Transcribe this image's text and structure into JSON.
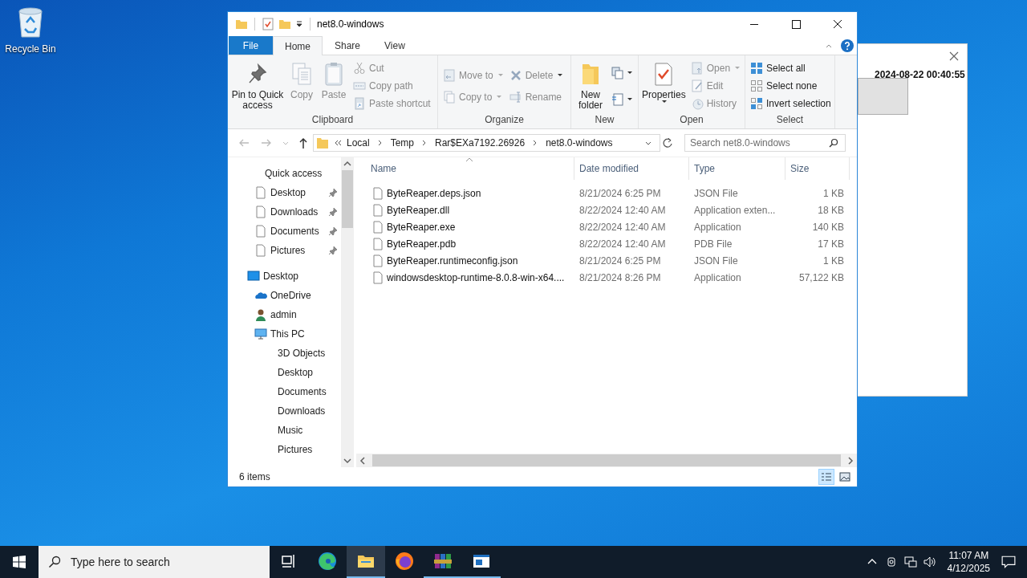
{
  "desktop_icons": [
    {
      "label": "Recycle Bin"
    }
  ],
  "background_window": {
    "timestamp": "2024-08-22 00:40:55"
  },
  "explorer": {
    "title": "net8.0-windows",
    "ribbon_tabs": [
      {
        "label": "File",
        "kind": "file",
        "selected": false
      },
      {
        "label": "Home",
        "kind": "tab",
        "selected": true
      },
      {
        "label": "Share",
        "kind": "tab",
        "selected": false
      },
      {
        "label": "View",
        "kind": "tab",
        "selected": false
      }
    ],
    "ribbon": {
      "clipboard": {
        "label": "Clipboard",
        "pin": {
          "label": "Pin to Quick access",
          "disabled": false
        },
        "copy": {
          "label": "Copy",
          "disabled": true
        },
        "paste": {
          "label": "Paste",
          "disabled": true
        },
        "cut": {
          "label": "Cut",
          "disabled": true
        },
        "copy_path": {
          "label": "Copy path",
          "disabled": true
        },
        "paste_shortcut": {
          "label": "Paste shortcut",
          "disabled": true
        }
      },
      "organize": {
        "label": "Organize",
        "move_to": {
          "label": "Move to",
          "disabled": true
        },
        "copy_to": {
          "label": "Copy to",
          "disabled": true
        },
        "delete": {
          "label": "Delete",
          "disabled": true
        },
        "rename": {
          "label": "Rename",
          "disabled": true
        }
      },
      "new": {
        "label": "New",
        "new_folder": {
          "label": "New folder",
          "disabled": false
        }
      },
      "open": {
        "label": "Open",
        "properties": {
          "label": "Properties",
          "disabled": false
        },
        "open": {
          "label": "Open",
          "disabled": true
        },
        "edit": {
          "label": "Edit",
          "disabled": true
        },
        "history": {
          "label": "History",
          "disabled": true
        }
      },
      "select": {
        "label": "Select",
        "select_all": {
          "label": "Select all",
          "disabled": false
        },
        "select_none": {
          "label": "Select none",
          "disabled": false
        },
        "invert_selection": {
          "label": "Invert selection",
          "disabled": false
        }
      }
    },
    "address": {
      "crumbs": [
        "Local",
        "Temp",
        "Rar$EXa7192.26926",
        "net8.0-windows"
      ]
    },
    "search": {
      "placeholder": "Search net8.0-windows"
    },
    "nav": {
      "quick_access": {
        "label": "Quick access",
        "items": [
          {
            "label": "Desktop",
            "pinned": true
          },
          {
            "label": "Downloads",
            "pinned": true
          },
          {
            "label": "Documents",
            "pinned": true
          },
          {
            "label": "Pictures",
            "pinned": true
          }
        ]
      },
      "tree": [
        {
          "label": "Desktop",
          "kind": "desktop",
          "children": [
            {
              "label": "OneDrive",
              "kind": "cloud"
            },
            {
              "label": "admin",
              "kind": "user"
            },
            {
              "label": "This PC",
              "kind": "pc",
              "children": [
                {
                  "label": "3D Objects"
                },
                {
                  "label": "Desktop"
                },
                {
                  "label": "Documents"
                },
                {
                  "label": "Downloads"
                },
                {
                  "label": "Music"
                },
                {
                  "label": "Pictures"
                }
              ]
            }
          ]
        }
      ]
    },
    "columns": [
      {
        "label": "Name",
        "sorted": true
      },
      {
        "label": "Date modified",
        "sorted": false
      },
      {
        "label": "Type",
        "sorted": false
      },
      {
        "label": "Size",
        "sorted": false
      }
    ],
    "files": [
      {
        "name": "ByteReaper.deps.json",
        "date": "8/21/2024 6:25 PM",
        "type": "JSON File",
        "size": "1 KB"
      },
      {
        "name": "ByteReaper.dll",
        "date": "8/22/2024 12:40 AM",
        "type": "Application exten...",
        "size": "18 KB"
      },
      {
        "name": "ByteReaper.exe",
        "date": "8/22/2024 12:40 AM",
        "type": "Application",
        "size": "140 KB"
      },
      {
        "name": "ByteReaper.pdb",
        "date": "8/22/2024 12:40 AM",
        "type": "PDB File",
        "size": "17 KB"
      },
      {
        "name": "ByteReaper.runtimeconfig.json",
        "date": "8/21/2024 6:25 PM",
        "type": "JSON File",
        "size": "1 KB"
      },
      {
        "name": "windowsdesktop-runtime-8.0.8-win-x64....",
        "date": "8/21/2024 8:26 PM",
        "type": "Application",
        "size": "57,122 KB"
      }
    ],
    "status": "6 items",
    "views": [
      {
        "kind": "details",
        "selected": true
      },
      {
        "kind": "large",
        "selected": false
      }
    ]
  },
  "taskbar": {
    "search_placeholder": "Type here to search",
    "apps": [
      {
        "kind": "taskview",
        "active": false,
        "running": false
      },
      {
        "kind": "edge",
        "active": false,
        "running": false
      },
      {
        "kind": "explorer",
        "active": true,
        "running": true
      },
      {
        "kind": "firefox",
        "active": false,
        "running": false
      },
      {
        "kind": "archive",
        "active": false,
        "running": true
      },
      {
        "kind": "window",
        "active": false,
        "running": true
      }
    ],
    "time": "11:07 AM",
    "date": "4/12/2025"
  }
}
